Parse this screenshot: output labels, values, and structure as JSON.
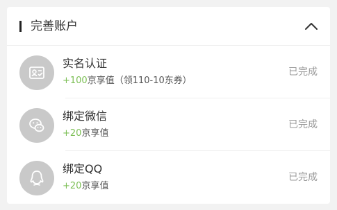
{
  "section": {
    "title": "完善账户",
    "collapse_icon": "chevron-up-icon"
  },
  "tasks": [
    {
      "icon": "id-card-icon",
      "name": "实名认证",
      "reward_plus": "+100",
      "reward_text": "京享值（领110-10东券）",
      "status": "已完成"
    },
    {
      "icon": "wechat-icon",
      "name": "绑定微信",
      "reward_plus": "+20",
      "reward_text": "京享值",
      "status": "已完成"
    },
    {
      "icon": "qq-icon",
      "name": "绑定QQ",
      "reward_plus": "+20",
      "reward_text": "京享值",
      "status": "已完成"
    }
  ],
  "colors": {
    "reward_accent": "#7cbf55",
    "avatar_bg": "#c9c9c9",
    "status_text": "#999999"
  }
}
